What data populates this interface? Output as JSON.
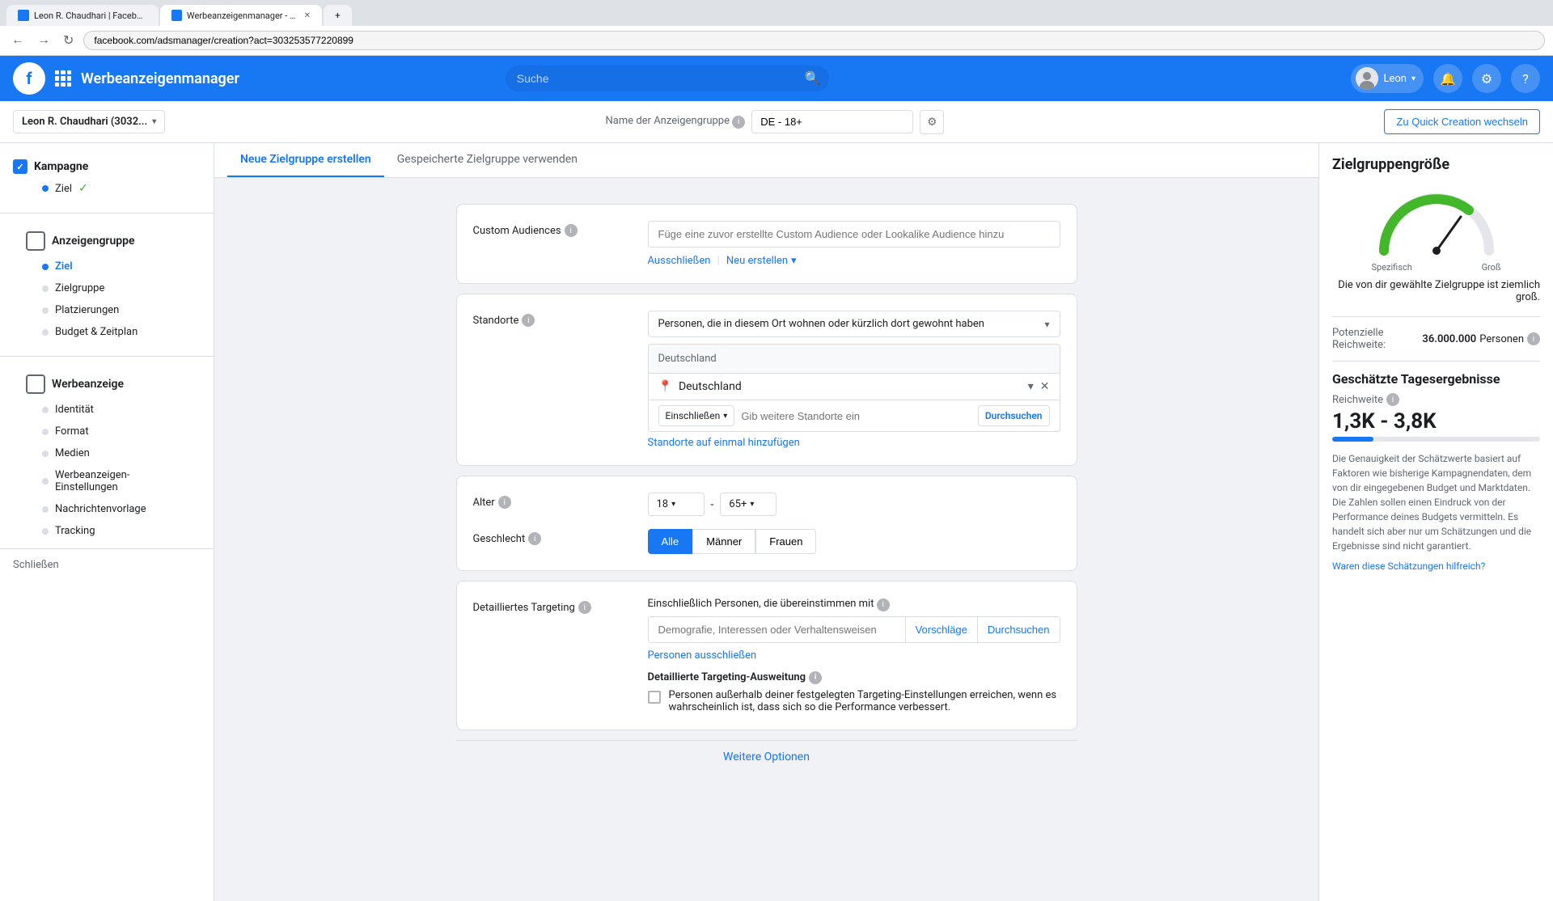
{
  "browser": {
    "tabs": [
      {
        "id": "tab1",
        "label": "Leon R. Chaudhari | Facebook",
        "active": false,
        "favicon": "fb"
      },
      {
        "id": "tab2",
        "label": "Werbeanzeigenmanager - Cr...",
        "active": true,
        "favicon": "fb"
      }
    ],
    "address": "facebook.com/adsmanager/creation?act=303253577220899"
  },
  "nav_buttons": {
    "back": "←",
    "forward": "→",
    "refresh": "↻"
  },
  "header": {
    "logo_text": "f",
    "app_name": "Werbeanzeigenmanager",
    "search_placeholder": "Suche",
    "user_name": "Leon",
    "bell_icon": "🔔",
    "gear_icon": "⚙",
    "help_icon": "?"
  },
  "sub_header": {
    "account_name": "Leon R. Chaudhari (3032...",
    "field_label": "Name der Anzeigengruppe",
    "field_value": "DE - 18+",
    "quick_create_btn": "Zu Quick Creation wechseln"
  },
  "tabs": [
    {
      "id": "neue",
      "label": "Neue Zielgruppe erstellen",
      "active": true
    },
    {
      "id": "gespeicherte",
      "label": "Gespeicherte Zielgruppe verwenden",
      "active": false
    }
  ],
  "sidebar": {
    "kampagne": {
      "title": "Kampagne",
      "items": [
        {
          "id": "ziel",
          "label": "Ziel",
          "state": "checked"
        }
      ]
    },
    "anzeigengruppe": {
      "title": "Anzeigengruppe",
      "items": [
        {
          "id": "ziel2",
          "label": "Ziel",
          "state": "active"
        },
        {
          "id": "zielgruppe",
          "label": "Zielgruppe",
          "state": "normal"
        },
        {
          "id": "platzierungen",
          "label": "Platzierungen",
          "state": "normal"
        },
        {
          "id": "budget",
          "label": "Budget & Zeitplan",
          "state": "normal"
        }
      ]
    },
    "werbeanzeige": {
      "title": "Werbeanzeige",
      "items": [
        {
          "id": "identitaet",
          "label": "Identität",
          "state": "normal"
        },
        {
          "id": "format",
          "label": "Format",
          "state": "normal"
        },
        {
          "id": "medien",
          "label": "Medien",
          "state": "normal"
        },
        {
          "id": "einstellungen",
          "label": "Werbeanzeigen-Einstellungen",
          "state": "normal"
        },
        {
          "id": "nachrichtenvorlage",
          "label": "Nachrichtenvorlage",
          "state": "normal"
        },
        {
          "id": "tracking",
          "label": "Tracking",
          "state": "normal"
        }
      ]
    },
    "close_btn": "Schließen"
  },
  "form": {
    "custom_audiences": {
      "label": "Custom Audiences",
      "placeholder": "Füge eine zuvor erstellte Custom Audience oder Lookalike Audience hinzu",
      "ausschliessen": "Ausschließen",
      "neu_erstellen": "Neu erstellen",
      "divider": "|"
    },
    "standorte": {
      "label": "Standorte",
      "option": "Personen, die in diesem Ort wohnen oder kürzlich dort gewohnt haben",
      "location_header": "Deutschland",
      "location_item": "Deutschland",
      "einschliessen": "Einschließen",
      "search_placeholder": "Gib weitere Standorte ein",
      "durchsuchen": "Durchsuchen",
      "add_link": "Standorte auf einmal hinzufügen"
    },
    "alter": {
      "label": "Alter",
      "min": "18",
      "max": "65+",
      "separator": "-"
    },
    "geschlecht": {
      "label": "Geschlecht",
      "buttons": [
        {
          "id": "alle",
          "label": "Alle",
          "active": true
        },
        {
          "id": "maenner",
          "label": "Männer",
          "active": false
        },
        {
          "id": "frauen",
          "label": "Frauen",
          "active": false
        }
      ]
    },
    "detailed_targeting": {
      "label": "Detailliertes Targeting",
      "sublabel": "Einschließlich Personen, die übereinstimmen mit",
      "placeholder": "Demografie, Interessen oder Verhaltensweisen",
      "vorschlaege": "Vorschläge",
      "durchsuchen": "Durchsuchen",
      "ausschliessen_link": "Personen ausschließen",
      "ausweitung_title": "Detaillierte Targeting-Ausweitung",
      "ausweitung_info": "ℹ",
      "ausweitung_text": "Personen außerhalb deiner festgelegten Targeting-Einstellungen erreichen, wenn es wahrscheinlich ist, dass sich so die Performance verbessert."
    },
    "weitere": "Weitere Optionen"
  },
  "right_panel": {
    "title": "Zielgruppengröße",
    "gauge": {
      "label_left": "Spezifisch",
      "label_right": "Groß",
      "description": "Die von dir gewählte Zielgruppe ist ziemlich groß."
    },
    "potential_reach": {
      "label": "Potenzielle Reichweite:",
      "value": "36.000.000",
      "unit": "Personen"
    },
    "estimated_title": "Geschätzte Tagesergebnisse",
    "reach_label": "Reichweite",
    "reach_value": "1,3K - 3,8K",
    "disclaimer": "Die Genauigkeit der Schätzwerte basiert auf Faktoren wie bisherige Kampagnendaten, dem von dir eingegebenen Budget und Marktdaten. Die Zahlen sollen einen Eindruck von der Performance deines Budgets vermitteln. Es handelt sich aber nur um Schätzungen und die Ergebnisse sind nicht garantiert.",
    "helpful_link": "Waren diese Schätzungen hilfreich?"
  }
}
